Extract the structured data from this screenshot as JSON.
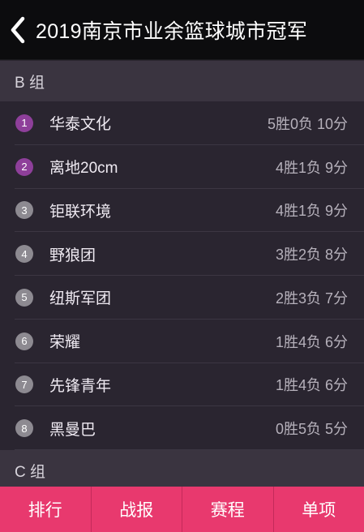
{
  "header": {
    "title": "2019南京市业余篮球城市冠军"
  },
  "groups": [
    {
      "label": "B 组"
    },
    {
      "label": "C 组"
    }
  ],
  "standings": [
    {
      "rank": "1",
      "team": "华泰文化",
      "record": "5胜0负 10分",
      "highlight": true
    },
    {
      "rank": "2",
      "team": "离地20cm",
      "record": "4胜1负 9分",
      "highlight": true
    },
    {
      "rank": "3",
      "team": "钜联环境",
      "record": "4胜1负 9分",
      "highlight": false
    },
    {
      "rank": "4",
      "team": "野狼团",
      "record": "3胜2负 8分",
      "highlight": false
    },
    {
      "rank": "5",
      "team": "纽斯军团",
      "record": "2胜3负 7分",
      "highlight": false
    },
    {
      "rank": "6",
      "team": "荣耀",
      "record": "1胜4负 6分",
      "highlight": false
    },
    {
      "rank": "7",
      "team": "先锋青年",
      "record": "1胜4负 6分",
      "highlight": false
    },
    {
      "rank": "8",
      "team": "黑曼巴",
      "record": "0胜5负 5分",
      "highlight": false
    }
  ],
  "tabs": [
    {
      "label": "排行"
    },
    {
      "label": "战报"
    },
    {
      "label": "赛程"
    },
    {
      "label": "单项"
    }
  ],
  "colors": {
    "accent": "#e8396e",
    "rank_top": "#8e3f9a",
    "rank_normal": "#8d8a91",
    "header_bg": "#0c0c0e"
  },
  "icons": {
    "back": "chevron-left-icon"
  }
}
